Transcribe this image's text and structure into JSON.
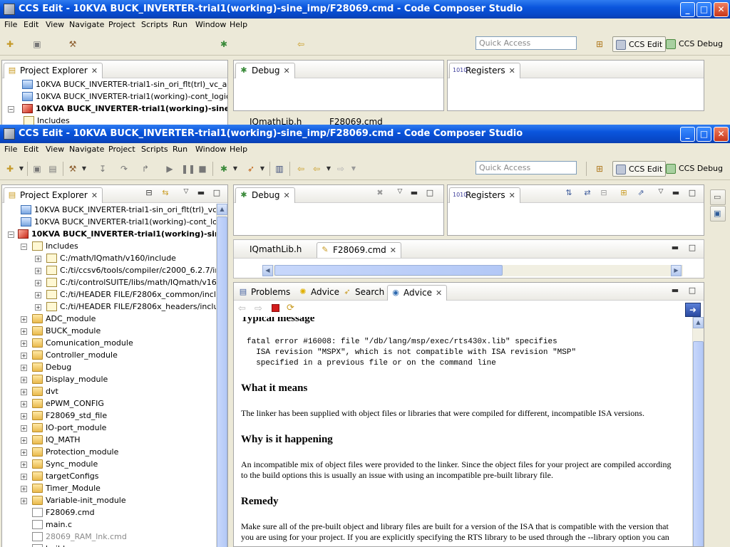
{
  "window_back": {
    "title": "CCS Edit - 10KVA BUCK_INVERTER-trial1(working)-sine_imp/F28069.cmd - Code Composer Studio",
    "tree_items": [
      "10KVA BUCK_INVERTER-trial1-sin_ori_flt(trl)_vc_ar_o",
      "10KVA BUCK_INVERTER-trial1(working)-cont_logic_cu",
      "10KVA BUCK_INVERTER-trial1(working)-sine_i",
      "Includes"
    ],
    "editor_tabs": [
      "IQmathLib.h",
      "F28069.cmd"
    ]
  },
  "window": {
    "title": "CCS Edit - 10KVA BUCK_INVERTER-trial1(working)-sine_imp/F28069.cmd - Code Composer Studio"
  },
  "menu": [
    "File",
    "Edit",
    "View",
    "Navigate",
    "Project",
    "Scripts",
    "Run",
    "Window",
    "Help"
  ],
  "toolbar": {
    "quick_access_placeholder": "Quick Access",
    "perspectives": [
      "CCS Edit",
      "CCS Debug"
    ]
  },
  "project_explorer": {
    "title": "Project Explorer",
    "items": [
      {
        "label": "10KVA BUCK_INVERTER-trial1-sin_ori_flt(trl)_vc_ar_o",
        "type": "project"
      },
      {
        "label": "10KVA BUCK_INVERTER-trial1(working)-cont_logic_cu",
        "type": "project"
      },
      {
        "label": "10KVA BUCK_INVERTER-trial1(working)-sine_i",
        "type": "active-project"
      },
      {
        "label": "Includes",
        "type": "includes"
      },
      {
        "label": "C:/math/IQmath/v160/include",
        "type": "include-path"
      },
      {
        "label": "C:/ti/ccsv6/tools/compiler/c2000_6.2.7/includ",
        "type": "include-path"
      },
      {
        "label": "C:/ti/controlSUITE/libs/math/IQmath/v160/inc",
        "type": "include-path"
      },
      {
        "label": "C:/ti/HEADER FILE/F2806x_common/include",
        "type": "include-path"
      },
      {
        "label": "C:/ti/HEADER FILE/F2806x_headers/include",
        "type": "include-path"
      },
      {
        "label": "ADC_module",
        "type": "folder"
      },
      {
        "label": "BUCK_module",
        "type": "folder"
      },
      {
        "label": "Comunication_module",
        "type": "folder"
      },
      {
        "label": "Controller_module",
        "type": "folder"
      },
      {
        "label": "Debug",
        "type": "folder"
      },
      {
        "label": "Display_module",
        "type": "folder"
      },
      {
        "label": "dvt",
        "type": "folder"
      },
      {
        "label": "ePWM_CONFIG",
        "type": "folder"
      },
      {
        "label": "F28069_std_file",
        "type": "folder"
      },
      {
        "label": "IO-port_module",
        "type": "folder"
      },
      {
        "label": "IQ_MATH",
        "type": "folder"
      },
      {
        "label": "Protection_module",
        "type": "folder"
      },
      {
        "label": "Sync_module",
        "type": "folder"
      },
      {
        "label": "targetConfigs",
        "type": "folder"
      },
      {
        "label": "Timer_Module",
        "type": "folder"
      },
      {
        "label": "Variable-init_module",
        "type": "folder"
      },
      {
        "label": "F28069.cmd",
        "type": "file"
      },
      {
        "label": "main.c",
        "type": "file"
      },
      {
        "label": "28069_RAM_lnk.cmd",
        "type": "file-excluded"
      },
      {
        "label": "build",
        "type": "file"
      }
    ]
  },
  "debug_view": {
    "title": "Debug"
  },
  "registers_view": {
    "title": "Registers"
  },
  "editor_tabs": [
    "IQmathLib.h",
    "F28069.cmd"
  ],
  "bottom_tabs": [
    "Problems",
    "Advice",
    "Search",
    "Advice"
  ],
  "advice": {
    "heading_top": "Typical message",
    "message_lines": [
      "fatal error #16008: file \"/db/lang/msp/exec/rts430x.lib\" specifies",
      "  ISA revision \"MSPX\", which is not compatible with ISA revision \"MSP\"",
      "  specified in a previous file or on the command line"
    ],
    "what_heading": "What it means",
    "what_text": "The linker has been supplied with object files or libraries that were compiled for different, incompatible ISA versions.",
    "why_heading": "Why is it happening",
    "why_text": "An incompatible mix of object files were provided to the linker. Since the object files for your project are compiled according to the build options this is usually an issue with using an incompatible pre-built library file.",
    "remedy_heading": "Remedy",
    "remedy_text": "Make sure all of the pre-built object and library files are built for a version of the ISA that is compatible with the version that you are using for your project. If you are explicitly specifying the RTS library to be used through the --library option you can"
  }
}
